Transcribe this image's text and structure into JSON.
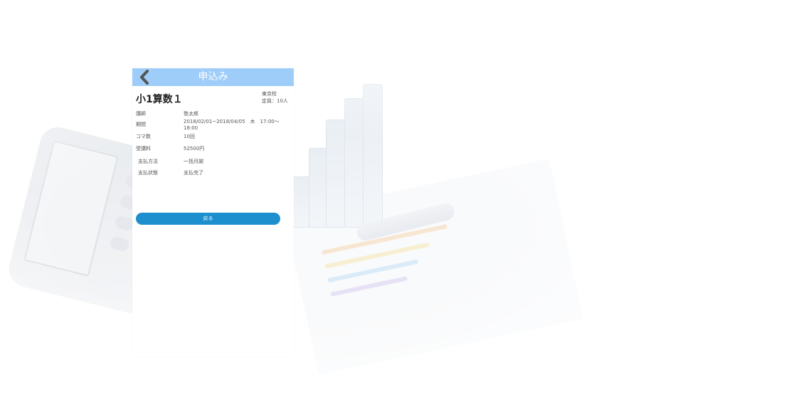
{
  "header": {
    "title": "申込み"
  },
  "course": {
    "title": "小1算数１",
    "campus": "東京校",
    "capacity": "定員：10人"
  },
  "details": [
    {
      "label": "講師",
      "value": "塾太郎"
    },
    {
      "label": "期間",
      "value": "2018/02/01~2018/04/05　木　17:00～18:00"
    },
    {
      "label": "コマ数",
      "value": "10回"
    },
    {
      "label": "受講料",
      "value": "52500円"
    },
    {
      "label": "支払方法",
      "value": "一括月謝"
    },
    {
      "label": "支払状態",
      "value": "支払完了"
    }
  ],
  "actions": {
    "back_label": "戻る"
  },
  "colors": {
    "header_bg": "#9fcdf9",
    "button_bg": "#1e8fce"
  },
  "icons": {
    "back": "chevron-left-icon"
  }
}
